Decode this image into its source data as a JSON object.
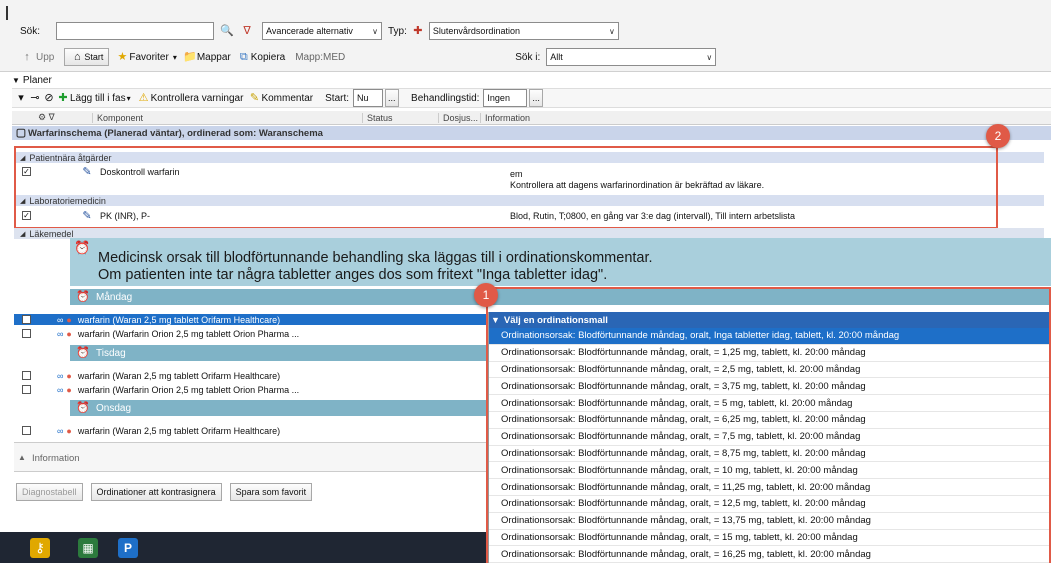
{
  "toolbar": {
    "search_label": "Sök:",
    "advanced_label": "Avancerade alternativ",
    "type_label": "Typ:",
    "type_value": "Slutenvårdsordination",
    "up_label": "Upp",
    "start_label": "Start",
    "favorites_label": "Favoriter",
    "folders_label": "Mappar",
    "copy_label": "Kopiera",
    "folder_path": "Mapp:MED",
    "search_in_label": "Sök i:",
    "search_in_value": "Allt"
  },
  "plans": {
    "header": "Planer",
    "add_to_phase": "Lägg till i fas",
    "check_warnings": "Kontrollera varningar",
    "comment": "Kommentar",
    "start_label": "Start:",
    "start_value": "Nu",
    "ellipsis": "...",
    "duration_label": "Behandlingstid:",
    "duration_value": "Ingen",
    "columns": [
      "Komponent",
      "Status",
      "Dosjus...",
      "Information"
    ],
    "plan_title": "Warfarinschema (Planerad väntar), ordinerad som: Waranschema",
    "groups": {
      "patient": "Patientnära åtgärder",
      "lab": "Laboratoriemedicin",
      "drugs": "Läkemedel"
    },
    "dose_control": {
      "name": "Doskontroll warfarin",
      "info1": "em",
      "info2": "Kontrollera att dagens warfarinordination är bekräftad av läkare."
    },
    "pk_inr": {
      "name": "PK (INR), P-",
      "info": "Blod, Rutin, T;0800, en gång var 3:e dag (intervall), Till intern arbetslista"
    },
    "note_line1": "Medicinsk orsak till blodförtunnande behandling ska läggas till i ordinationskommentar.",
    "note_line2": "Om patienten inte tar några tabletter anges dos som fritext \"Inga tabletter idag\".",
    "days": [
      "Måndag",
      "Tisdag",
      "Onsdag"
    ],
    "med_waran": "warfarin (Waran 2,5 mg tablett Orifarm Healthcare)",
    "med_orion": "warfarin (Warfarin Orion 2,5 mg tablett Orion Pharma ..."
  },
  "dropdown": {
    "header": "Välj en ordinationsmall",
    "items": [
      "Ordinationsorsak: Blodförtunnande måndag, oralt, Inga tabletter idag, tablett, kl. 20:00 måndag",
      "Ordinationsorsak: Blodförtunnande måndag, oralt, = 1,25 mg, tablett, kl. 20:00 måndag",
      "Ordinationsorsak: Blodförtunnande måndag, oralt, = 2,5 mg, tablett, kl. 20:00 måndag",
      "Ordinationsorsak: Blodförtunnande måndag, oralt, = 3,75 mg, tablett, kl. 20:00 måndag",
      "Ordinationsorsak: Blodförtunnande måndag, oralt, = 5 mg, tablett, kl. 20:00 måndag",
      "Ordinationsorsak: Blodförtunnande måndag, oralt, = 6,25 mg, tablett, kl. 20:00 måndag",
      "Ordinationsorsak: Blodförtunnande måndag, oralt, = 7,5 mg, tablett, kl. 20:00 måndag",
      "Ordinationsorsak: Blodförtunnande måndag, oralt, = 8,75 mg, tablett, kl. 20:00 måndag",
      "Ordinationsorsak: Blodförtunnande måndag, oralt, = 10 mg, tablett, kl. 20:00 måndag",
      "Ordinationsorsak: Blodförtunnande måndag, oralt, = 11,25 mg, tablett, kl. 20:00 måndag",
      "Ordinationsorsak: Blodförtunnande måndag, oralt, = 12,5 mg, tablett, kl. 20:00 måndag",
      "Ordinationsorsak: Blodförtunnande måndag, oralt, = 13,75 mg, tablett, kl. 20:00 måndag",
      "Ordinationsorsak: Blodförtunnande måndag, oralt, = 15 mg, tablett, kl. 20:00 måndag",
      "Ordinationsorsak: Blodförtunnande måndag, oralt, = 16,25 mg, tablett, kl. 20:00 måndag"
    ]
  },
  "info_panel": {
    "label": "Information"
  },
  "bottom": {
    "diag": "Diagnostabell",
    "countersign": "Ordinationer att kontrasignera",
    "save_fav": "Spara som favorit"
  },
  "badges": {
    "one": "1",
    "two": "2"
  },
  "colors": {
    "highlight": "#e05a47",
    "selection": "#1e6fc8",
    "teal": "#a9cfdc"
  }
}
